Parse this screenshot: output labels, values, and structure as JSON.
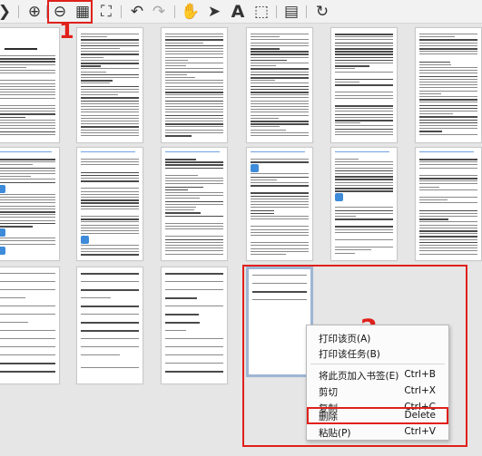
{
  "toolbar": {
    "buttons": [
      {
        "name": "previous-page-icon",
        "glyph": "❯"
      },
      {
        "name": "zoom-in-icon",
        "glyph": "⊕"
      },
      {
        "name": "zoom-out-icon",
        "glyph": "⊖"
      },
      {
        "name": "thumbnail-grid-icon",
        "glyph": "▦"
      },
      {
        "name": "fit-page-icon",
        "glyph": "⛶"
      },
      {
        "name": "undo-icon",
        "glyph": "↶"
      },
      {
        "name": "redo-icon",
        "glyph": "↷"
      },
      {
        "name": "hand-tool-icon",
        "glyph": "✋"
      },
      {
        "name": "select-arrow-icon",
        "glyph": "➤"
      },
      {
        "name": "text-select-icon",
        "glyph": "A"
      },
      {
        "name": "marquee-select-icon",
        "glyph": "⬚"
      },
      {
        "name": "page-properties-icon",
        "glyph": "▤"
      },
      {
        "name": "refresh-icon",
        "glyph": "↻"
      }
    ]
  },
  "annotations": {
    "step1": "1",
    "step2": "2",
    "color": "#e0201b"
  },
  "context_menu": {
    "items": [
      {
        "label": "打印该页(A)",
        "shortcut": ""
      },
      {
        "label": "打印该任务(B)",
        "shortcut": ""
      },
      {
        "label": "将此页加入书签(E)",
        "shortcut": "Ctrl+B"
      },
      {
        "label": "剪切",
        "shortcut": "Ctrl+X"
      },
      {
        "label": "复制",
        "shortcut": "Ctrl+C"
      },
      {
        "label": "删除",
        "shortcut": "Delete"
      },
      {
        "label": "粘贴(P)",
        "shortcut": "Ctrl+V"
      }
    ]
  },
  "colors": {
    "annotation": "#e0201b",
    "selection_border": "#9fb6d4",
    "background": "#e6e6e6"
  }
}
